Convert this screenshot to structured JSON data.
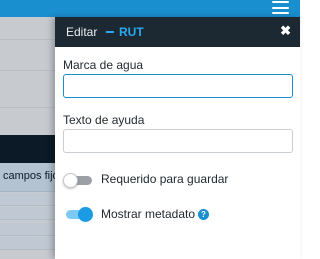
{
  "panel": {
    "title": "Editar",
    "subject": "RUT",
    "close_icon": "close-icon",
    "fields": [
      {
        "label": "Marca de agua",
        "value": "",
        "placeholder": ""
      },
      {
        "label": "Texto de ayuda",
        "value": "",
        "placeholder": ""
      }
    ],
    "toggles": [
      {
        "label": "Requerido para guardar",
        "on": false
      },
      {
        "label": "Mostrar metadato",
        "on": true,
        "help_icon": "question-icon"
      }
    ]
  },
  "background": {
    "column_header": "campos fijo"
  },
  "colors": {
    "accent": "#1a8fd0",
    "header_bg": "#1c2832",
    "subject": "#29a9f0"
  }
}
